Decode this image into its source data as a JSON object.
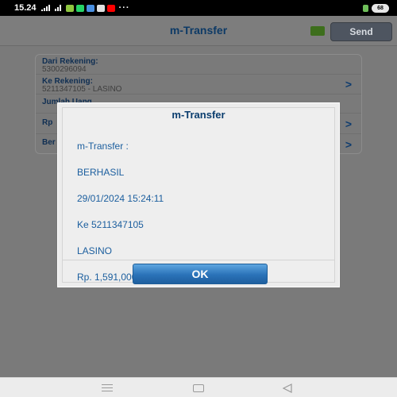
{
  "status_bar": {
    "time": "15.24",
    "overflow": "···",
    "battery": "68",
    "icons": [
      "signal-icon",
      "notification-icon",
      "whatsapp-icon",
      "app-icon",
      "mail-icon",
      "youtube-icon"
    ]
  },
  "header": {
    "title": "m-Transfer",
    "send_label": "Send"
  },
  "form": {
    "from_label": "Dari Rekening:",
    "from_value": "5300296094",
    "to_label": "Ke Rekening:",
    "to_value": "5211347105 - LASINO",
    "amount_label": "Jumlah Uang",
    "amount_prefix": "Rp",
    "extra_prefix": "Ber"
  },
  "dialog": {
    "title": "m-Transfer",
    "lines": [
      "m-Transfer :",
      "BERHASIL",
      "29/01/2024 15:24:11",
      "Ke 5211347105",
      "LASINO",
      "Rp. 1,591,000.00"
    ],
    "ok_label": "OK"
  },
  "colors": {
    "header_title": "#0d3a66",
    "dialog_text": "#1b5e9e",
    "ok_button": "#2a72b8",
    "dim_overlay": "#7a7a7a"
  }
}
